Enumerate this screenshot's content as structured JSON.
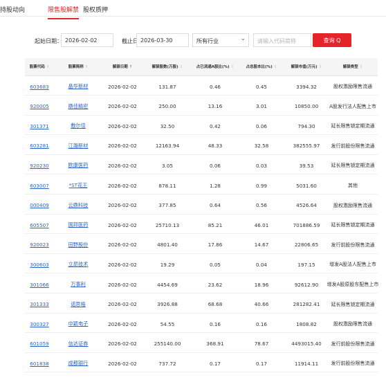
{
  "tabs": [
    {
      "label": "持股动向",
      "active": false
    },
    {
      "label": "限售股解禁",
      "active": true
    },
    {
      "label": "股权质押",
      "active": false
    }
  ],
  "filter": {
    "start_label": "起始日期：",
    "start_value": "2026-02-02",
    "end_label": "截止日期：",
    "end_value": "2026-03-30",
    "industry_value": "所有行业",
    "search_placeholder": "请输入代码简称",
    "query_label": "查询 Q"
  },
  "table": {
    "headers": [
      "股票代码",
      "股票简称",
      "解禁日期",
      "解禁股数(万股)",
      "占已流通A股比(%)",
      "占总股本比(%)",
      "解禁市值(万元)",
      "解禁类型"
    ],
    "rows": [
      {
        "code": "603683",
        "name": "晶华新材",
        "date": "2026-02-02",
        "shares": "131.87",
        "pct_float": "0.46",
        "pct_total": "0.45",
        "value": "3394.32",
        "type": "股权激励限售流通"
      },
      {
        "code": "920005",
        "name": "鼎佳精密",
        "date": "2026-02-02",
        "shares": "250.00",
        "pct_float": "13.16",
        "pct_total": "3.01",
        "value": "10850.00",
        "type": "A股发行法人配售上市"
      },
      {
        "code": "301371",
        "name": "敷尔佳",
        "date": "2026-02-02",
        "shares": "32.50",
        "pct_float": "0.42",
        "pct_total": "0.06",
        "value": "794.30",
        "type": "延长限售锁定期流通"
      },
      {
        "code": "603281",
        "name": "江瀚新材",
        "date": "2026-02-02",
        "shares": "12163.94",
        "pct_float": "48.33",
        "pct_total": "32.58",
        "value": "382555.97",
        "type": "发行前股份限售流通"
      },
      {
        "code": "920230",
        "name": "欧康医药",
        "date": "2026-02-02",
        "shares": "3.05",
        "pct_float": "0.06",
        "pct_total": "0.03",
        "value": "39.53",
        "type": "延长限售锁定期流通"
      },
      {
        "code": "603007",
        "name": "*ST花王",
        "date": "2026-02-02",
        "shares": "878.11",
        "pct_float": "1.28",
        "pct_total": "0.99",
        "value": "5031.60",
        "type": "其他"
      },
      {
        "code": "000409",
        "name": "云鼎科技",
        "date": "2026-02-02",
        "shares": "377.85",
        "pct_float": "0.64",
        "pct_total": "0.56",
        "value": "4526.64",
        "type": "股权激励限售流通"
      },
      {
        "code": "605507",
        "name": "国邦医药",
        "date": "2026-02-02",
        "shares": "25710.13",
        "pct_float": "85.21",
        "pct_total": "46.01",
        "value": "701886.59",
        "type": "延长限售锁定期流通"
      },
      {
        "code": "920023",
        "name": "田野股份",
        "date": "2026-02-02",
        "shares": "4801.40",
        "pct_float": "17.86",
        "pct_total": "14.67",
        "value": "22806.65",
        "type": "发行前股份限售流通"
      },
      {
        "code": "300603",
        "name": "立昂技术",
        "date": "2026-02-02",
        "shares": "19.29",
        "pct_float": "0.05",
        "pct_total": "0.04",
        "value": "197.15",
        "type": "增发A股法人配售上市"
      },
      {
        "code": "301066",
        "name": "万事利",
        "date": "2026-02-02",
        "shares": "4454.69",
        "pct_float": "23.62",
        "pct_total": "18.96",
        "value": "92612.90",
        "type": "增发A股原股东配售上市"
      },
      {
        "code": "301333",
        "name": "诺思格",
        "date": "2026-02-02",
        "shares": "3926.88",
        "pct_float": "68.68",
        "pct_total": "40.66",
        "value": "281282.41",
        "type": "延长限售锁定期流通"
      },
      {
        "code": "300327",
        "name": "中颖电子",
        "date": "2026-02-02",
        "shares": "54.55",
        "pct_float": "0.16",
        "pct_total": "0.16",
        "value": "1808.82",
        "type": "股权激励限售流通"
      },
      {
        "code": "601059",
        "name": "信达证券",
        "date": "2026-02-02",
        "shares": "255140.00",
        "pct_float": "368.91",
        "pct_total": "78.67",
        "value": "4493015.40",
        "type": "发行前股份限售流通"
      },
      {
        "code": "601838",
        "name": "成都银行",
        "date": "2026-02-02",
        "shares": "737.72",
        "pct_float": "0.17",
        "pct_total": "0.17",
        "value": "11914.11",
        "type": "发行前股份限售流通"
      }
    ]
  },
  "colors": {
    "accent": "#e3242b",
    "link": "#2a63c5"
  },
  "icons": {
    "sort": "sort-arrows-icon",
    "sort_active": "sort-up-icon",
    "select": "chevron-down-icon",
    "search": "magnifier-icon"
  }
}
